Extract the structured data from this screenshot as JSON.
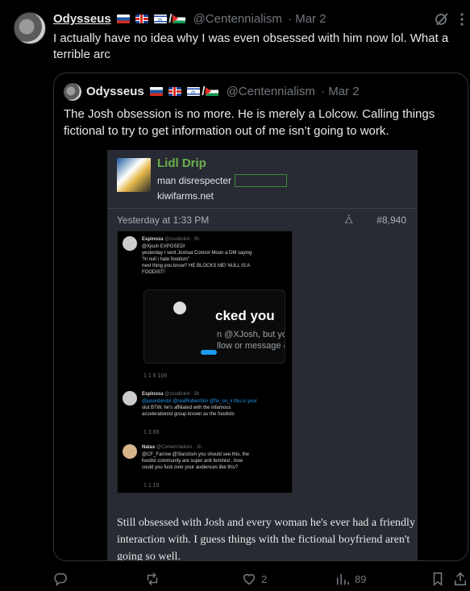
{
  "tweet": {
    "name": "Odysseus",
    "flags": [
      "russia-flag-icon",
      "uk-flag-icon",
      "israel-flag-icon",
      "palestine-flag-icon"
    ],
    "slash": "/",
    "handle": "@Centennialism",
    "date": "· Mar 2",
    "text": "I actually have no idea why I was even obsessed with him now lol. What a terrible arc"
  },
  "quote": {
    "name": "Odysseus",
    "slash": "/",
    "handle": "@Centennialism",
    "date": "· Mar 2",
    "text": "The Josh obsession is no more. He is merely a Lolcow. Calling things fictional to try to get information out of me isn’t going to work."
  },
  "media": {
    "site_title": "Lidl Drip",
    "site_sub": "man disrespecter",
    "site_url": "kiwifarms.net",
    "post_date": "Yesterday at 1:33 PM",
    "post_num": "#8,940",
    "inner": {
      "t1_name": "Espinoza",
      "t1_handle": "@zoodistiol · 5h",
      "t1_line1": "@Xjosh EXPOSED!",
      "t1_line2": "yesterday I sent Joshua Connor Moon a DM saying",
      "t1_line3": "\"hi null i hate foodism\"",
      "t1_line4": "next thing you know? HE BLOCKS ME! NULL IS A",
      "t1_line5": "FOODIST!",
      "blocked": "cked you",
      "blocked_sub1": "n @XJosh, but yo",
      "blocked_sub2": "llow or message @",
      "t1_stats": "1      1      6      109",
      "t2_name": "Espinoza",
      "t2_handle": "@zoodistiol · 5h",
      "t2_line1": "@jasonbindol @realRubenSim @fix_on_x this is your",
      "t2_line2": "slut BTW, he's affiliated with the infamous",
      "t2_line3": "accelerationist group known as the foodists",
      "t2_stats": "1             3      65",
      "t3_name": "Natas",
      "t3_handle": "@Centennialism · 1h",
      "t3_line1": "@CF_Farrow @Slanzism you should see this, the",
      "t3_line2": "foodist community are super anti feminist , how",
      "t3_line3": "could you fuck over your audiences like this?",
      "t3_stats": "1                    1      15"
    },
    "caption": "Still obsessed with Josh and every woman he's ever had a friendly interaction with. I guess things with the fictional boyfriend aren't going so well."
  },
  "actions": {
    "likes": "2",
    "views": "89"
  }
}
